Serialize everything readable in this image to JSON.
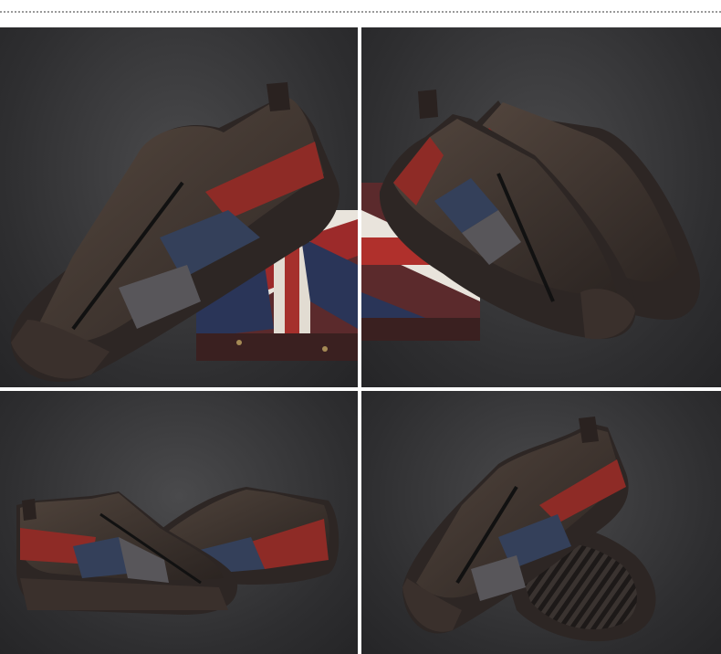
{
  "product": {
    "kind": "men-slip-on-zip-leather-sneaker",
    "colors": {
      "upper": "#3e3530",
      "red": "#8e2b26",
      "blue": "#34405a",
      "gray": "#58565a",
      "sole": "#2d2624",
      "background": "#323234"
    }
  },
  "panels": [
    {
      "view": "side-angle-single-shoe"
    },
    {
      "view": "pair-angled"
    },
    {
      "view": "pair-side"
    },
    {
      "view": "single-with-sole-tread"
    }
  ]
}
